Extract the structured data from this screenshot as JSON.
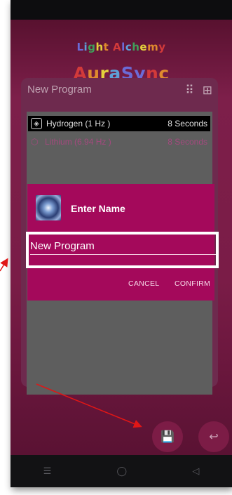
{
  "brand": {
    "subtitle": "Light Alchemy",
    "title": "AuraSync",
    "subtitle_colors": [
      "#6b6bd6",
      "#5ea0d8",
      "#3fa05a",
      "#e2d13c",
      "#e08a2e",
      "#d23a3a"
    ],
    "title_colors": [
      "#d23a3a",
      "#e08a2e",
      "#e2d13c",
      "#5ea0d8",
      "#6b6bd6",
      "#6b6bd6"
    ]
  },
  "card": {
    "title": "New Program",
    "grid_icon": "grid-icon",
    "add_icon": "add-box-icon"
  },
  "program_list": [
    {
      "label": "Hydrogen (1 Hz )",
      "duration": "8 Seconds",
      "selected": true
    },
    {
      "label": "Lithium (6.94 Hz )",
      "duration": "8 Seconds",
      "selected": false
    }
  ],
  "dialog": {
    "title": "Enter Name",
    "input_value": "New Program",
    "cancel_label": "CANCEL",
    "confirm_label": "CONFIRM",
    "background": "#a4095b"
  },
  "fabs": {
    "save_icon": "save-icon",
    "back_icon": "return-icon"
  },
  "navbar": {
    "menu_icon": "☰",
    "home_icon": "◯",
    "back_icon": "◁"
  },
  "annotation": {
    "color": "#e01616"
  }
}
